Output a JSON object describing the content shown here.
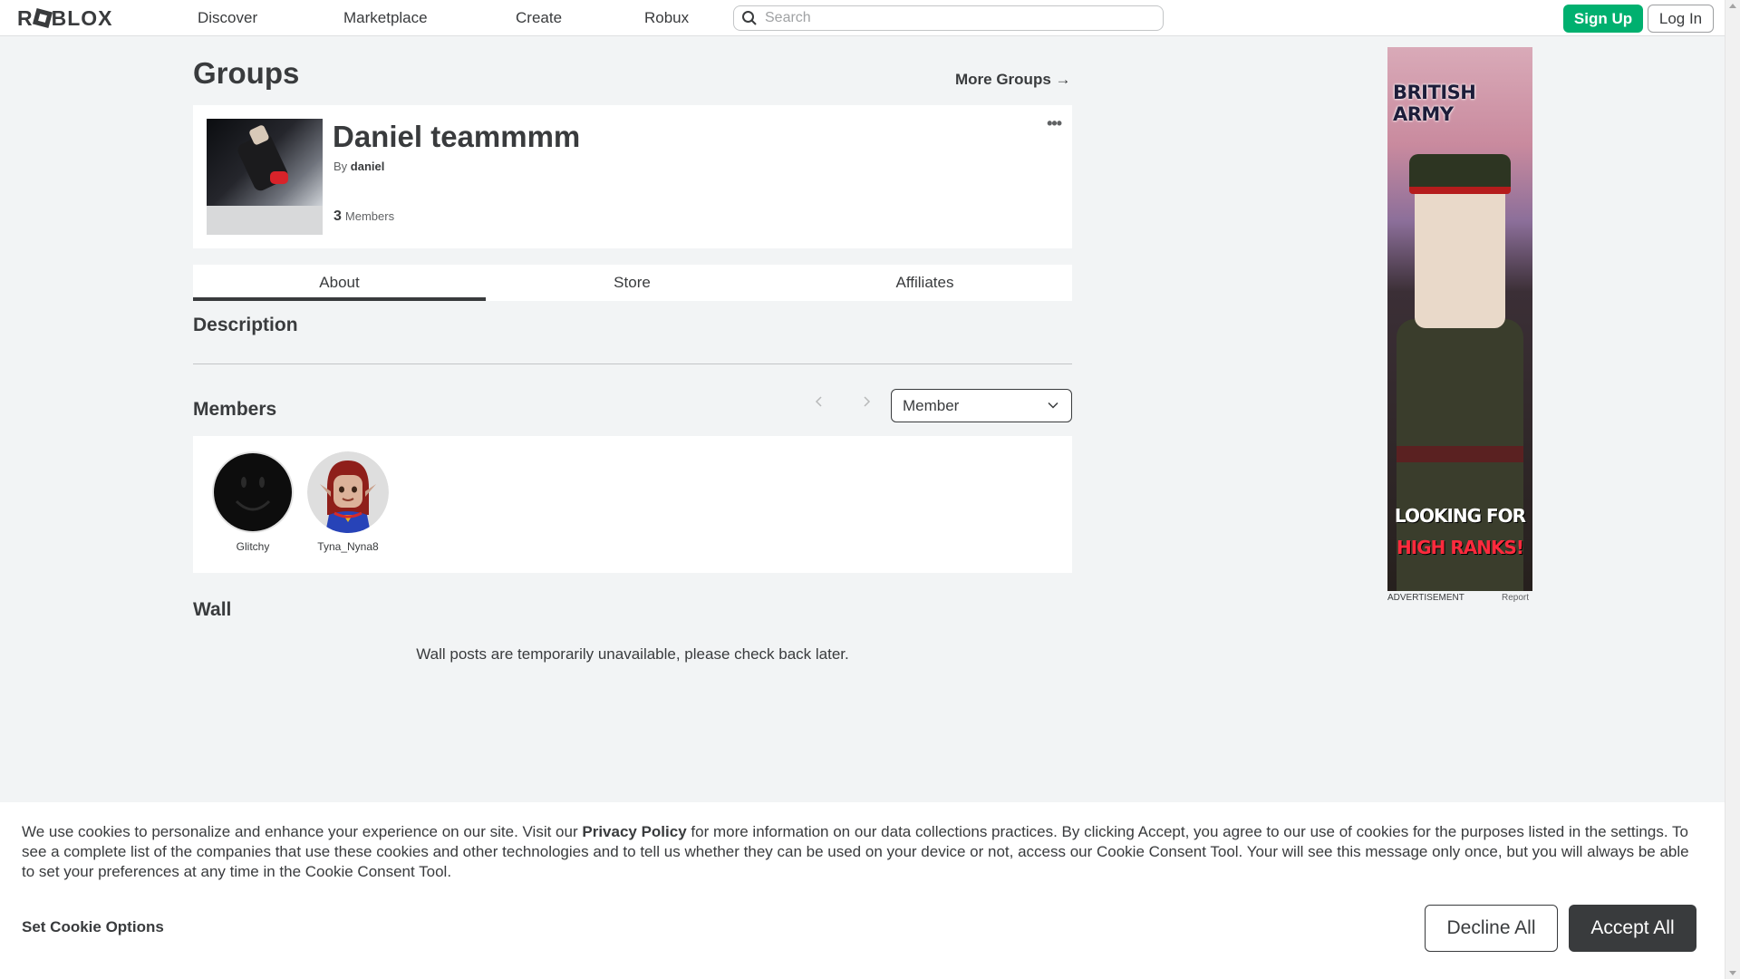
{
  "nav": {
    "logo": "ROBLOX",
    "links": [
      "Discover",
      "Marketplace",
      "Create",
      "Robux"
    ],
    "search_placeholder": "Search",
    "signup_label": "Sign Up",
    "login_label": "Log In"
  },
  "page": {
    "title": "Groups",
    "more_groups": "More Groups →"
  },
  "group": {
    "name": "Daniel teammmm",
    "by_label": "By",
    "owner": "daniel",
    "member_count": "3",
    "members_label": "Members",
    "menu_label": "•••"
  },
  "tabs": [
    "About",
    "Store",
    "Affiliates"
  ],
  "sections": {
    "description": "Description",
    "members": "Members",
    "wall": "Wall"
  },
  "members": {
    "role_selected": "Member",
    "list": [
      {
        "name": "Glitchy"
      },
      {
        "name": "Tyna_Nyna8"
      }
    ]
  },
  "wall": {
    "message": "Wall posts are temporarily unavailable, please check back later."
  },
  "ad": {
    "title": "BRITISH ARMY",
    "line1": "LOOKING FOR",
    "line2": "HIGH RANKS!",
    "label": "ADVERTISEMENT",
    "report": "Report"
  },
  "cookie": {
    "text_before": "We use cookies to personalize and enhance your experience on our site. Visit our ",
    "privacy_link": "Privacy Policy",
    "text_after": " for more information on our data collections practices. By clicking Accept, you agree to our use of cookies for the purposes listed in the settings. To see a complete list of the companies that use these cookies and other technologies and to tell us whether they can be used on your device or not, access our Cookie Consent Tool. Your will see this message only once, but you will always be able to set your preferences at any time in the Cookie Consent Tool.",
    "options_label": "Set Cookie Options",
    "decline_label": "Decline All",
    "accept_label": "Accept All"
  },
  "colors": {
    "accent_green": "#00b06f",
    "text_dark": "#393b3d",
    "background": "#f2f4f5"
  }
}
